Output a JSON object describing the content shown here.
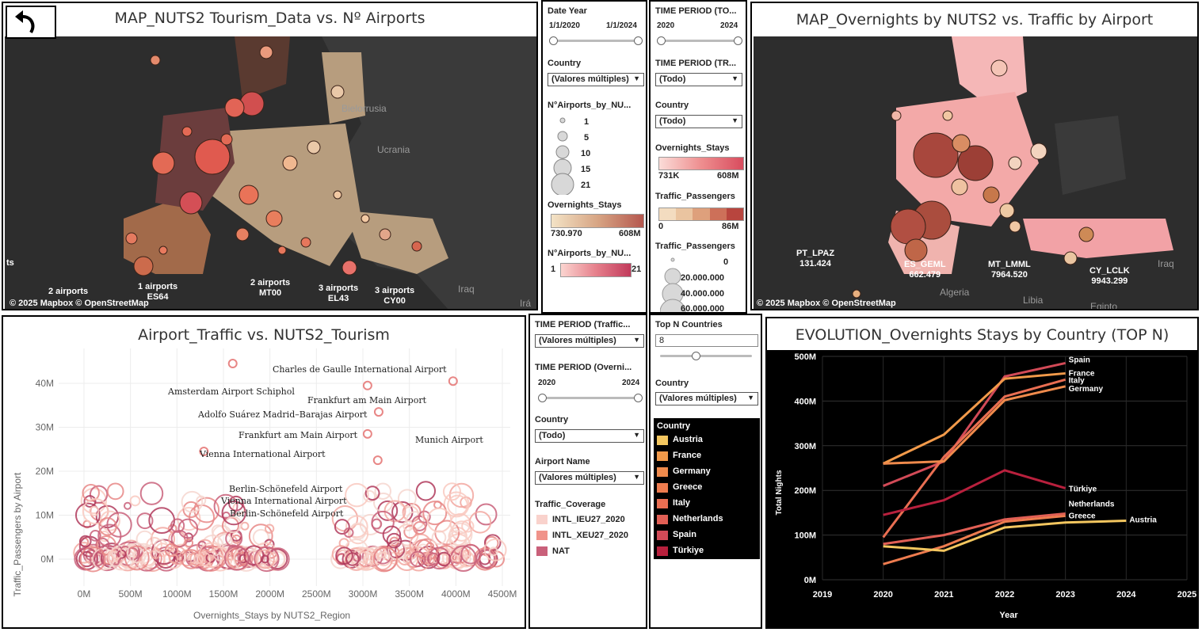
{
  "map1": {
    "title": "MAP_NUTS2 Tourism_Data vs. Nº Airports",
    "attribution": "© 2025 Mapbox  © OpenStreetMap",
    "geo_labels": [
      "Bielorrusia",
      "Ucrania",
      "Iraq",
      "Irá"
    ],
    "point_labels": [
      {
        "count": "2 airports",
        "code": ""
      },
      {
        "count": "1 airports",
        "code": "ES64"
      },
      {
        "count": "2 airports",
        "code": "MT00"
      },
      {
        "count": "3 airports",
        "code": "EL43"
      },
      {
        "count": "3 airports",
        "code": "CY00"
      }
    ],
    "edge_label": "ts"
  },
  "filters1": {
    "date_year": {
      "label": "Date Year",
      "min": "1/1/2020",
      "max": "1/1/2024"
    },
    "country": {
      "label": "Country",
      "value": "(Valores múltiples)"
    },
    "airports_size": {
      "label": "N°Airports_by_NU...",
      "items": [
        "1",
        "5",
        "10",
        "15",
        "21"
      ]
    },
    "overnights_color": {
      "label": "Overnights_Stays",
      "min": "730.970",
      "max": "608M"
    },
    "airports_color": {
      "label": "N°Airports_by_NU...",
      "min": "1",
      "max": "21"
    }
  },
  "filters2": {
    "time_period_1": {
      "label": "TIME PERIOD (TO...",
      "min": "2020",
      "max": "2024"
    },
    "time_period_2": {
      "label": "TIME PERIOD (TR...",
      "value": "(Todo)"
    },
    "country": {
      "label": "Country",
      "value": "(Todo)"
    },
    "overnights_color": {
      "label": "Overnights_Stays",
      "min": "731K",
      "max": "608M"
    },
    "traffic_color": {
      "label": "Traffic_Passengers",
      "min": "0",
      "max": "86M"
    },
    "traffic_size": {
      "label": "Traffic_Passengers",
      "items": [
        "0",
        "20.000.000",
        "40.000.000",
        "60.000.000"
      ]
    }
  },
  "map2": {
    "title": "MAP_Overnights by NUTS2 vs. Traffic by Airport",
    "attribution": "© 2025 Mapbox  © OpenStreetMap",
    "geo_labels": [
      "Algeria",
      "Libia",
      "Egipto",
      "Iraq"
    ],
    "point_labels": [
      {
        "code": "PT_LPAZ",
        "value": "131.424"
      },
      {
        "code": "ES_GEML",
        "value": "662.479"
      },
      {
        "code": "MT_LMML",
        "value": "7964.520"
      },
      {
        "code": "CY_LCLK",
        "value": "9943.299"
      }
    ]
  },
  "scatter": {
    "title": "Airport_Traffic vs. NUTS2_Tourism",
    "xlabel": "Overnights_Stays by NUTS2_Region",
    "ylabel": "Traffic_Passengers by Airport",
    "xticks": [
      "0M",
      "500M",
      "1000M",
      "1500M",
      "2000M",
      "2500M",
      "3000M",
      "3500M",
      "4000M",
      "4500M"
    ],
    "yticks": [
      "0M",
      "10M",
      "20M",
      "30M",
      "40M"
    ],
    "annotations": [
      "Charles de Gaulle International Airport",
      "Amsterdam Airport Schiphol",
      "Frankfurt am Main Airport",
      "Adolfo Suárez Madrid–Barajas Airport",
      "Frankfurt am Main Airport",
      "Munich Airport",
      "Vienna International Airport",
      "Berlin-Schönefeld Airport",
      "Vienna International Airport",
      "Berlin-Schönefeld Airport"
    ]
  },
  "filters3": {
    "time_period_traffic": {
      "label": "TIME PERIOD (Traffic...",
      "value": "(Valores múltiples)"
    },
    "time_period_overnights": {
      "label": "TIME PERIOD (Overni...",
      "min": "2020",
      "max": "2024"
    },
    "country": {
      "label": "Country",
      "value": "(Todo)"
    },
    "airport": {
      "label": "Airport Name",
      "value": "(Valores múltiples)"
    },
    "coverage": {
      "label": "Traffic_Coverage",
      "items": [
        {
          "name": "INTL_IEU27_2020",
          "color": "#f9d2cc"
        },
        {
          "name": "INTL_XEU27_2020",
          "color": "#f0938a"
        },
        {
          "name": "NAT",
          "color": "#c9607a"
        }
      ]
    }
  },
  "filters4": {
    "topn": {
      "label": "Top N Countries",
      "value": "8"
    },
    "country": {
      "label": "Country",
      "value": "(Valores múltiples)"
    },
    "legend": {
      "label": "Country",
      "items": [
        {
          "name": "Austria",
          "color": "#f3c65f"
        },
        {
          "name": "France",
          "color": "#f29a4a"
        },
        {
          "name": "Germany",
          "color": "#ef8a4c"
        },
        {
          "name": "Greece",
          "color": "#ee7c4f"
        },
        {
          "name": "Italy",
          "color": "#e96e52"
        },
        {
          "name": "Netherlands",
          "color": "#e15f55"
        },
        {
          "name": "Spain",
          "color": "#d24a57"
        },
        {
          "name": "Türkiye",
          "color": "#b8203d"
        }
      ]
    }
  },
  "evolution": {
    "title": "EVOLUTION_Overnights Stays by Country (TOP N)",
    "xlabel": "Year",
    "ylabel": "Total Nights"
  },
  "chart_data": [
    {
      "type": "line",
      "title": "EVOLUTION_Overnights Stays by Country (TOP N)",
      "xlabel": "Year",
      "ylabel": "Total Nights",
      "x": [
        2020,
        2021,
        2022,
        2023,
        2024
      ],
      "xlim": [
        2019,
        2025
      ],
      "ylim": [
        0,
        500
      ],
      "yticks": [
        "0M",
        "100M",
        "200M",
        "300M",
        "400M",
        "500M"
      ],
      "xticks": [
        "2019",
        "2020",
        "2021",
        "2022",
        "2023",
        "2024",
        "2025"
      ],
      "grid": true,
      "series": [
        {
          "name": "Spain",
          "color": "#d24a57",
          "values": [
            210,
            265,
            455,
            485,
            null
          ]
        },
        {
          "name": "France",
          "color": "#f29a4a",
          "values": [
            260,
            325,
            450,
            462,
            null
          ]
        },
        {
          "name": "Italy",
          "color": "#e96e52",
          "values": [
            95,
            275,
            410,
            448,
            null
          ]
        },
        {
          "name": "Germany",
          "color": "#ef8a4c",
          "values": [
            260,
            265,
            402,
            433,
            null
          ]
        },
        {
          "name": "Türkiye",
          "color": "#b8203d",
          "values": [
            145,
            178,
            245,
            205,
            null
          ]
        },
        {
          "name": "Netherlands",
          "color": "#e15f55",
          "values": [
            80,
            100,
            135,
            148,
            null
          ]
        },
        {
          "name": "Greece",
          "color": "#ee7c4f",
          "values": [
            35,
            75,
            130,
            143,
            null
          ]
        },
        {
          "name": "Austria",
          "color": "#f3c65f",
          "values": [
            75,
            65,
            117,
            128,
            132
          ]
        }
      ],
      "end_labels": [
        "Spain",
        "France",
        "Italy",
        "Germany",
        "Türkiye",
        "Netherlands",
        "Greece",
        "Austria"
      ]
    },
    {
      "type": "scatter",
      "title": "Airport_Traffic vs. NUTS2_Tourism",
      "xlabel": "Overnights_Stays by NUTS2_Region",
      "ylabel": "Traffic_Passengers by Airport",
      "xlim": [
        -200,
        4600
      ],
      "ylim": [
        -3,
        47
      ],
      "labeled_points": [
        {
          "label": "Charles de Gaulle International Airport",
          "x": 3050,
          "y": 39.5
        },
        {
          "label": "Amsterdam Airport Schiphol",
          "x": 1600,
          "y": 44.5
        },
        {
          "label": "Frankfurt am Main Airport",
          "x": 3170,
          "y": 33.5
        },
        {
          "label": "Adolfo Suárez Madrid–Barajas Airport",
          "x": 3050,
          "y": 28.5
        },
        {
          "label": "Munich Airport",
          "x": 3970,
          "y": 40.5
        },
        {
          "label": "Vienna International Airport",
          "x": 1290,
          "y": 24.5
        },
        {
          "label": "Berlin-Schönefeld Airport",
          "x": 3160,
          "y": 22.5
        }
      ]
    }
  ]
}
